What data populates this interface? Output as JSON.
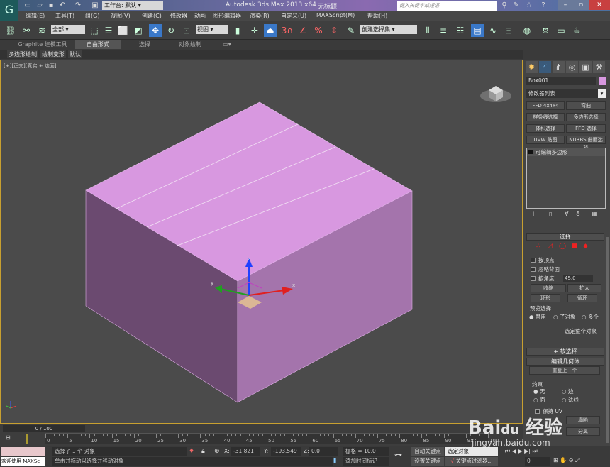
{
  "title": {
    "app": "Autodesk 3ds Max  2013 x64",
    "document": "无标题",
    "workspace": "工作台: 默认",
    "search_placeholder": "键入关键字或短语"
  },
  "menu": [
    "编辑(E)",
    "工具(T)",
    "组(G)",
    "视图(V)",
    "创建(C)",
    "修改器",
    "动画",
    "图形编辑器",
    "渲染(R)",
    "自定义(U)",
    "MAXScript(M)",
    "帮助(H)"
  ],
  "toolbar": {
    "selection_filter": "全部",
    "ref_coord": "视图",
    "named_selection": "创建选择集",
    "snap_3": "3",
    "snap_percent": "%"
  },
  "ribbon": {
    "tabs": [
      "Graphite 建模工具",
      "自由形式",
      "选择",
      "对象绘制"
    ],
    "active_tab": "自由形式",
    "subtabs": [
      "多边形绘制",
      "绘制变形",
      "默认"
    ]
  },
  "viewport": {
    "label": "[+][正交][真实 + 边面]",
    "axis_labels": {
      "x": "x",
      "y": "y",
      "z": "z"
    }
  },
  "colors": {
    "object": "#d898e0",
    "viewport_bg": "#4b4b4b",
    "accent": "#3a78c8"
  },
  "panel": {
    "object_name": "Box001",
    "modifier_list": "修改器列表",
    "modifier_buttons": [
      "FFD 4x4x4",
      "弯曲",
      "样条线选择",
      "多边形选择",
      "体积选择",
      "FFD 选择",
      "UVW 贴图",
      "NURBS 曲面选择"
    ],
    "stack": [
      "可编辑多边形"
    ],
    "selection": {
      "title": "选择",
      "by_vertex": "按顶点",
      "ignore_backfacing": "忽略背面",
      "by_angle": "按角度:",
      "angle_value": "45.0",
      "shrink": "收缩",
      "grow": "扩大",
      "ring": "环形",
      "loop": "循环",
      "preview_group": "预览选择",
      "preview_options": [
        "禁用",
        "子对象",
        "多个"
      ],
      "preview_selected": "禁用",
      "select_whole": "选定整个对象"
    },
    "soft_selection": "软选择",
    "edit_geometry": {
      "title": "编辑几何体",
      "repeat_last": "重复上一个",
      "constraints_label": "约束",
      "constraints": [
        "无",
        "边",
        "面",
        "法线"
      ],
      "constraint_selected": "无",
      "preserve_uv": "保持 UV",
      "collapse": "塌陷",
      "detach": "分离"
    }
  },
  "timeline": {
    "frame": "0 / 100",
    "ticks": [
      "0",
      "5",
      "10",
      "15",
      "20",
      "25",
      "30",
      "35",
      "40",
      "45",
      "50",
      "55",
      "60",
      "65",
      "70",
      "75",
      "80",
      "85",
      "90",
      "95",
      "100"
    ]
  },
  "status": {
    "welcome": "欢迎使用 MAXSc",
    "selected": "选择了 1 个 对象",
    "prompt": "单击并拖动以选择并移动对象",
    "x_label": "X:",
    "x": "-31.821",
    "y_label": "Y:",
    "y": "-193.549",
    "z_label": "Z:",
    "z": "0.0",
    "grid": "栅格 = 10.0",
    "add_time_tag": "添加时间标记",
    "auto_key": "自动关键点",
    "set_key": "设置关键点",
    "key_mode": "选定对象",
    "key_filters": "关键点过滤器...",
    "current_frame": "0"
  },
  "watermark": {
    "brand": "Bai du 经验",
    "url": "jingyan.baidu.com"
  }
}
